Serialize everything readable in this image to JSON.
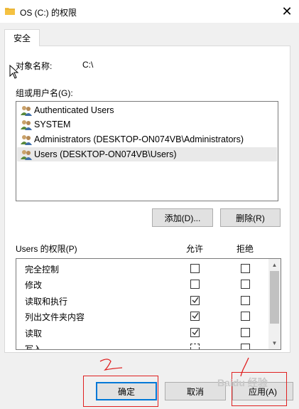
{
  "window": {
    "title": "OS (C:) 的权限",
    "close_symbol": "✕"
  },
  "tabs": [
    {
      "label": "安全",
      "active": true
    }
  ],
  "object": {
    "label": "对象名称:",
    "value": "C:\\"
  },
  "groups": {
    "label": "组或用户名(G):",
    "items": [
      {
        "name": "Authenticated Users",
        "selected": false
      },
      {
        "name": "SYSTEM",
        "selected": false
      },
      {
        "name": "Administrators (DESKTOP-ON074VB\\Administrators)",
        "selected": false
      },
      {
        "name": "Users (DESKTOP-ON074VB\\Users)",
        "selected": true
      }
    ]
  },
  "buttons": {
    "add": "添加(D)...",
    "remove": "删除(R)",
    "ok": "确定",
    "cancel": "取消",
    "apply": "应用(A)"
  },
  "permissions": {
    "label": "Users 的权限(P)",
    "allow_header": "允许",
    "deny_header": "拒绝",
    "rows": [
      {
        "name": "完全控制",
        "allow": false,
        "deny": false
      },
      {
        "name": "修改",
        "allow": false,
        "deny": false
      },
      {
        "name": "读取和执行",
        "allow": true,
        "deny": false
      },
      {
        "name": "列出文件夹内容",
        "allow": true,
        "deny": false
      },
      {
        "name": "读取",
        "allow": true,
        "deny": false
      },
      {
        "name": "写入",
        "allow": false,
        "deny": false
      }
    ]
  },
  "icons": {
    "title": "folder-icon",
    "user": "user-group-icon",
    "scroll_up": "chevron-up-icon",
    "scroll_down": "chevron-down-icon"
  },
  "watermark": "Baidu 经验",
  "colors": {
    "annotation": "#e02020",
    "focus": "#0078d7",
    "folder": "#f5c242"
  }
}
